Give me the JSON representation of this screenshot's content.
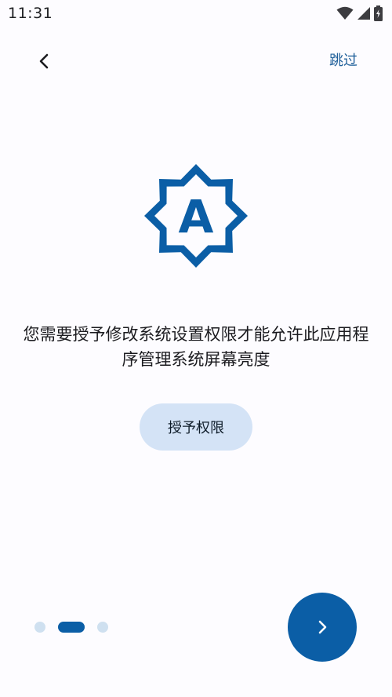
{
  "status_bar": {
    "time": "11:31",
    "icons": [
      "wifi-icon",
      "cellular-signal-icon",
      "battery-charging-icon"
    ]
  },
  "toolbar": {
    "back_icon": "chevron-left-icon",
    "skip_label": "跳过"
  },
  "hero": {
    "icon": "auto-brightness-icon",
    "glyph": "A"
  },
  "main": {
    "description": "您需要授予修改系统设置权限才能允许此应用程序管理系统屏幕亮度",
    "grant_label": "授予权限"
  },
  "pager": {
    "page_count": 3,
    "current_page": 2
  },
  "next": {
    "icon": "chevron-right-icon"
  },
  "colors": {
    "primary": "#0b5ea6",
    "secondary_container": "#d4e3f6",
    "background": "#fdfcff",
    "text": "#1b1b1f",
    "skip_text": "#1d5e99"
  }
}
